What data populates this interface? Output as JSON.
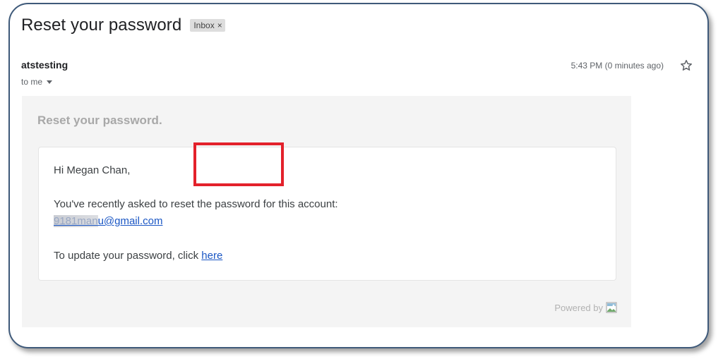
{
  "email": {
    "subject": "Reset your password",
    "label": "Inbox",
    "label_remove": "×",
    "sender": "atstesting",
    "recipient": "to me",
    "timestamp": "5:43 PM (0 minutes ago)"
  },
  "body": {
    "heading": "Reset your password.",
    "greeting": "Hi Megan Chan,",
    "info_text": "You've recently asked to reset the password for this account:",
    "account_email_prefix": "9181man",
    "account_email_suffix": "u@gmail.com",
    "update_text": "To update your password, click ",
    "update_link": "here",
    "footer_text": "Powered by"
  },
  "icons": {
    "star": "star-outline-icon",
    "dropdown": "caret-down-icon",
    "broken_image": "broken-image-icon"
  },
  "colors": {
    "link": "#1a56c4",
    "annotation_box": "#e3212b",
    "frame_border": "#3f5a7a",
    "body_background": "#f4f4f4"
  }
}
